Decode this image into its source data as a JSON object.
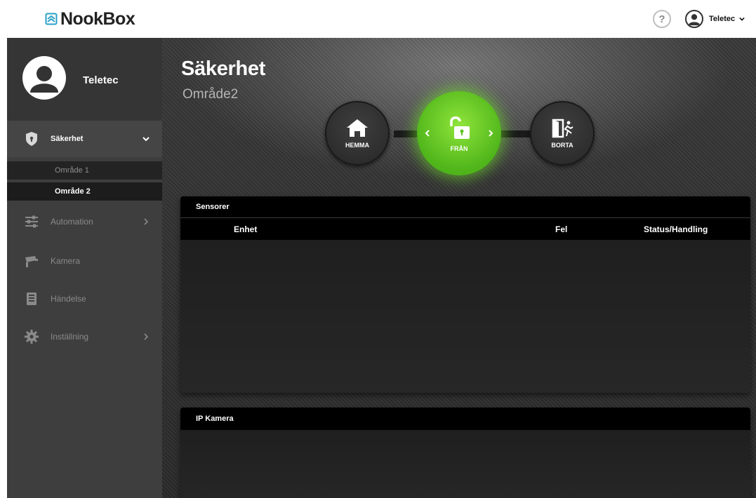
{
  "header": {
    "logo_text": "NookBox",
    "help_label": "?",
    "user_name": "Teletec"
  },
  "sidebar": {
    "profile_name": "Teletec",
    "items": [
      {
        "label": "Säkerhet",
        "icon": "shield-icon",
        "active": true,
        "expanded": true
      },
      {
        "label": "Automation",
        "icon": "sliders-icon",
        "has_submenu": true
      },
      {
        "label": "Kamera",
        "icon": "camera-icon"
      },
      {
        "label": "Händelse",
        "icon": "list-icon"
      },
      {
        "label": "Inställning",
        "icon": "gear-icon",
        "has_submenu": true
      }
    ],
    "subitems": [
      {
        "label": "Område 1",
        "selected": false
      },
      {
        "label": "Område 2",
        "selected": true
      }
    ]
  },
  "main": {
    "title": "Säkerhet",
    "subtitle": "Område2",
    "modes": [
      {
        "label": "HEMMA",
        "icon": "home-icon"
      },
      {
        "label": "FRÅN",
        "icon": "unlock-icon",
        "active": true
      },
      {
        "label": "BORTA",
        "icon": "door-exit-icon"
      }
    ],
    "sensors_panel": {
      "title": "Sensorer",
      "columns": [
        "Enhet",
        "Fel",
        "Status/Handling"
      ],
      "rows": []
    },
    "camera_panel": {
      "title": "IP Kamera"
    }
  },
  "colors": {
    "active_mode": "#5cc41f",
    "sidebar_bg": "#3e3e3e",
    "panel_header": "#000000"
  }
}
